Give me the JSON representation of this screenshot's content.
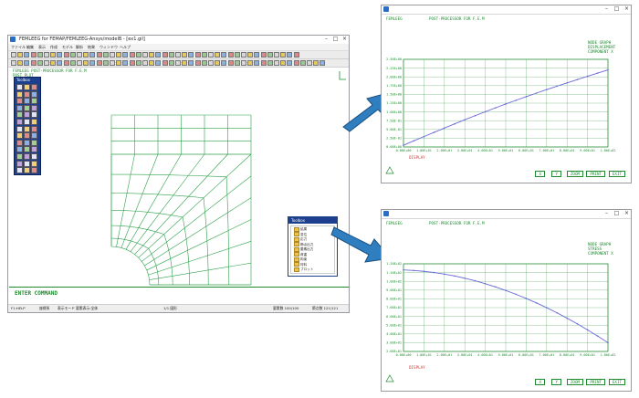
{
  "main_window": {
    "title": "FEMLEEG for FEMAP/FEMLEEG-Ansys/modelB - [ex1.gil]",
    "menus": [
      "ファイル",
      "編集",
      "表示",
      "作成",
      "モデル",
      "解析",
      "結果",
      "ウィンドウ",
      "ヘルプ"
    ],
    "header_line1": "FEMLEEG    POST-PROCESSOR   FOR   F.E.M",
    "header_line2": "POST PLOT",
    "command_prompt": "ENTER  COMMAND",
    "status": {
      "left": "F1:HELP",
      "items": [
        "座標系",
        "表示モード",
        "要素表示:全体"
      ],
      "center": "1/1 図形",
      "right1": "要素数 100/100",
      "right2": "節点数 121/121"
    }
  },
  "palette": {
    "title": "Toolbox"
  },
  "tree_window": {
    "title": "Toolbox",
    "items": [
      "結果",
      "変位",
      "応力",
      "節点出力",
      "要素出力",
      "荷重",
      "拘束",
      "材料",
      "プロット"
    ]
  },
  "plot_top": {
    "title_left": "FEMLEEG",
    "title_right": "POST-PROCESSOR   FOR   F.E.M",
    "header_right": [
      "NODE GRAPH",
      "DISPLACEMENT",
      "COMPONENT X"
    ],
    "yticks": [
      "2.50E+00",
      "2.25E+00",
      "2.00E+00",
      "1.75E+00",
      "1.50E+00",
      "1.25E+00",
      "1.00E+00",
      "7.50E-01",
      "5.00E-01",
      "2.50E-01",
      "0.00E+00"
    ],
    "xticks": [
      "0.00E+00",
      "1.00E+01",
      "2.00E+01",
      "3.00E+01",
      "4.00E+01",
      "5.00E+01",
      "6.00E+01",
      "7.00E+01",
      "8.00E+01",
      "9.00E+01",
      "1.00E+02"
    ],
    "legend": "DISPLAY",
    "status_cells": [
      "X",
      "Y",
      "ZOOM",
      "PRINT",
      "EXIT"
    ]
  },
  "plot_bottom": {
    "title_left": "FEMLEEG",
    "title_right": "POST-PROCESSOR   FOR   F.E.M",
    "header_right": [
      "NODE GRAPH",
      "STRESS",
      "COMPONENT X"
    ],
    "yticks": [
      "1.20E+02",
      "1.10E+02",
      "1.00E+02",
      "9.00E+01",
      "8.00E+01",
      "7.00E+01",
      "6.00E+01",
      "5.00E+01",
      "4.00E+01",
      "3.00E+01",
      "2.00E+01"
    ],
    "xticks": [
      "0.00E+00",
      "1.00E+01",
      "2.00E+01",
      "3.00E+01",
      "4.00E+01",
      "5.00E+01",
      "6.00E+01",
      "7.00E+01",
      "8.00E+01",
      "9.00E+01",
      "1.00E+02"
    ],
    "legend": "DISPLAY",
    "status_cells": [
      "X",
      "Y",
      "ZOOM",
      "PRINT",
      "EXIT"
    ]
  },
  "colors": {
    "graph_green": "#1f8a2f",
    "mesh_green": "#2ca04a",
    "curve_blue": "#6a6ad8",
    "arrow_blue": "#2f7fc0",
    "title_blue": "#1c3f8e"
  }
}
